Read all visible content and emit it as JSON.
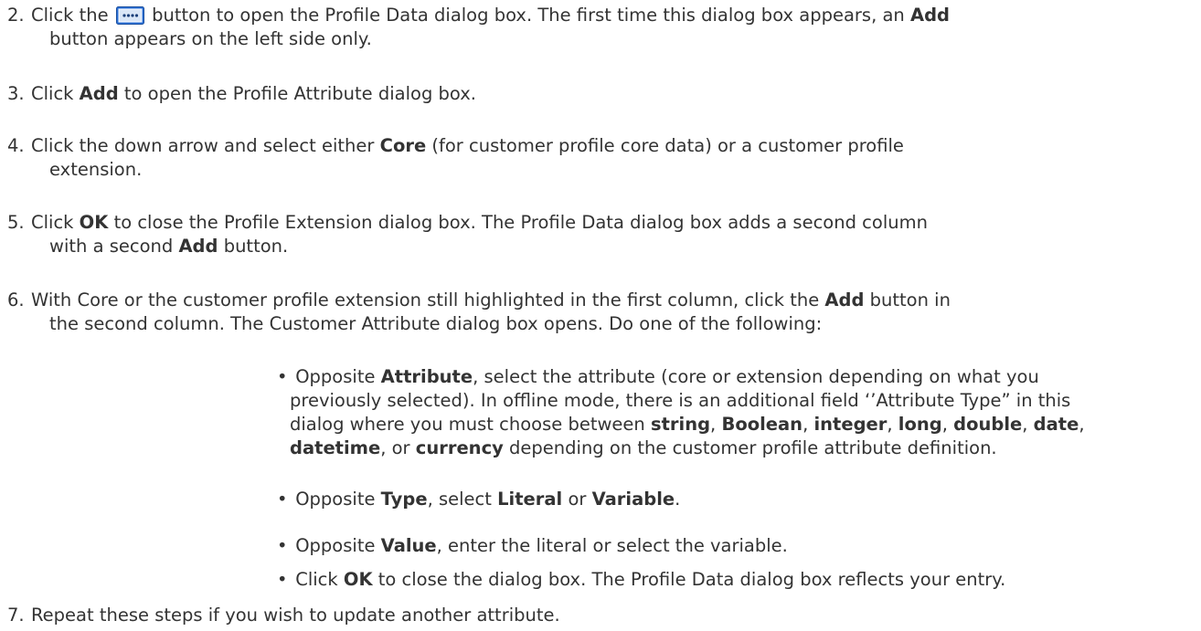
{
  "icons": {
    "profile_data_button": "ellipsis-button-icon",
    "button_color": "#2a6fd6"
  },
  "steps": [
    {
      "number": "2.",
      "line1_a": "Click the",
      "line1_b": "button to open the Profile Data dialog box.  The first time this dialog box appears, an",
      "line1_bold": "Add",
      "line2": "button appears  on the left side only."
    },
    {
      "number": "3.",
      "a": "Click",
      "bold": "Add",
      "b": " to open the Profile Attribute dialog box."
    },
    {
      "number": "4.",
      "a": "Click the down arrow and select either",
      "bold": "Core",
      "b": "(for customer profile core data) or a customer profile",
      "line2": "extension."
    },
    {
      "number": "5.",
      "a": "Click",
      "bold": "OK",
      "b": "to close the Profile Extension dialog box. The Profile Data dialog box adds a second column",
      "line2_a": "with a second",
      "line2_bold": "Add",
      "line2_b": "button."
    },
    {
      "number": "6.",
      "a": "With Core or the customer profile extension still highlighted in the first column, click the",
      "bold": "Add",
      "b": "button in",
      "line2": "the second column. The Customer Attribute dialog box opens. Do one of the following:"
    },
    {
      "number": "7.",
      "text": "Repeat these steps if you wish to update another attribute."
    }
  ],
  "bullets": [
    {
      "mark": "•",
      "a": "Opposite",
      "bold": "Attribute",
      "b": ", select the attribute (core or extension depending on what you",
      "line2": "previously selected). In offline mode, there is an additional field ‘’Attribute Type” in this",
      "line3_a": "dialog where you must choose between",
      "t_string": "string",
      "t_boolean": "Boolean",
      "t_integer": "integer",
      "t_long": "long",
      "t_double": "double",
      "t_date": "date",
      "sep": ",",
      "t_datetime": "datetime",
      "line4_or": ", or",
      "t_currency": "currency",
      "line4_b": "depending on the customer profile attribute definition."
    },
    {
      "mark": "•",
      "a": "Opposite",
      "bold": "Type",
      "b": ", select",
      "bold2": "Literal",
      "c": "or",
      "bold3": "Variable",
      "d": "."
    },
    {
      "mark": "•",
      "a": "Opposite",
      "bold": "Value",
      "b": ", enter the literal or select the variable."
    },
    {
      "mark": "•",
      "a": "Click",
      "bold": "OK",
      "b": "to close the dialog box. The Profile Data dialog box reflects your entry."
    }
  ]
}
